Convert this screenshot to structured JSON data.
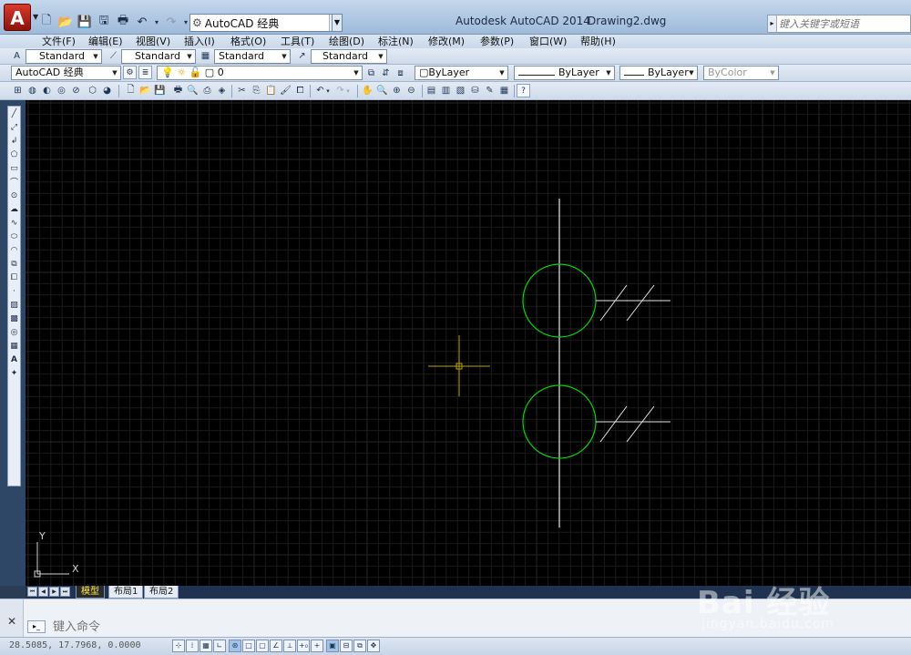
{
  "titlebar": {
    "app_title": "Autodesk AutoCAD 2014",
    "doc_title": "Drawing2.dwg",
    "workspace": "AutoCAD 经典",
    "search_placeholder": "键入关键字或短语"
  },
  "menu": [
    {
      "label": "文件(F)"
    },
    {
      "label": "编辑(E)"
    },
    {
      "label": "视图(V)"
    },
    {
      "label": "插入(I)"
    },
    {
      "label": "格式(O)"
    },
    {
      "label": "工具(T)"
    },
    {
      "label": "绘图(D)"
    },
    {
      "label": "标注(N)"
    },
    {
      "label": "修改(M)"
    },
    {
      "label": "参数(P)"
    },
    {
      "label": "窗口(W)"
    },
    {
      "label": "帮助(H)"
    }
  ],
  "styles_toolbar": {
    "text_style": "Standard",
    "dim_style": "Standard",
    "table_style": "Standard",
    "mleader_style": "Standard"
  },
  "layers_toolbar": {
    "workspace": "AutoCAD 经典",
    "layer": "0",
    "color": "ByLayer",
    "linetype": "ByLayer",
    "lineweight": "ByLayer",
    "plotstyle": "ByColor"
  },
  "canvas": {
    "background": "#000000",
    "grid_color": "#1a1a1a",
    "geometry_color_white": "#e6e6e6",
    "geometry_color_green": "#00d600",
    "crosshair_color": "#b7a300",
    "ucs_x_label": "X",
    "ucs_y_label": "Y"
  },
  "layout_tabs": {
    "model": "模型",
    "layout1": "布局1",
    "layout2": "布局2"
  },
  "command": {
    "placeholder": "键入命令"
  },
  "status": {
    "coords": "28.5085,  17.7968,  0.0000"
  },
  "watermark": {
    "main": "Bai 经验",
    "sub": "jingyan.baidu.com"
  }
}
